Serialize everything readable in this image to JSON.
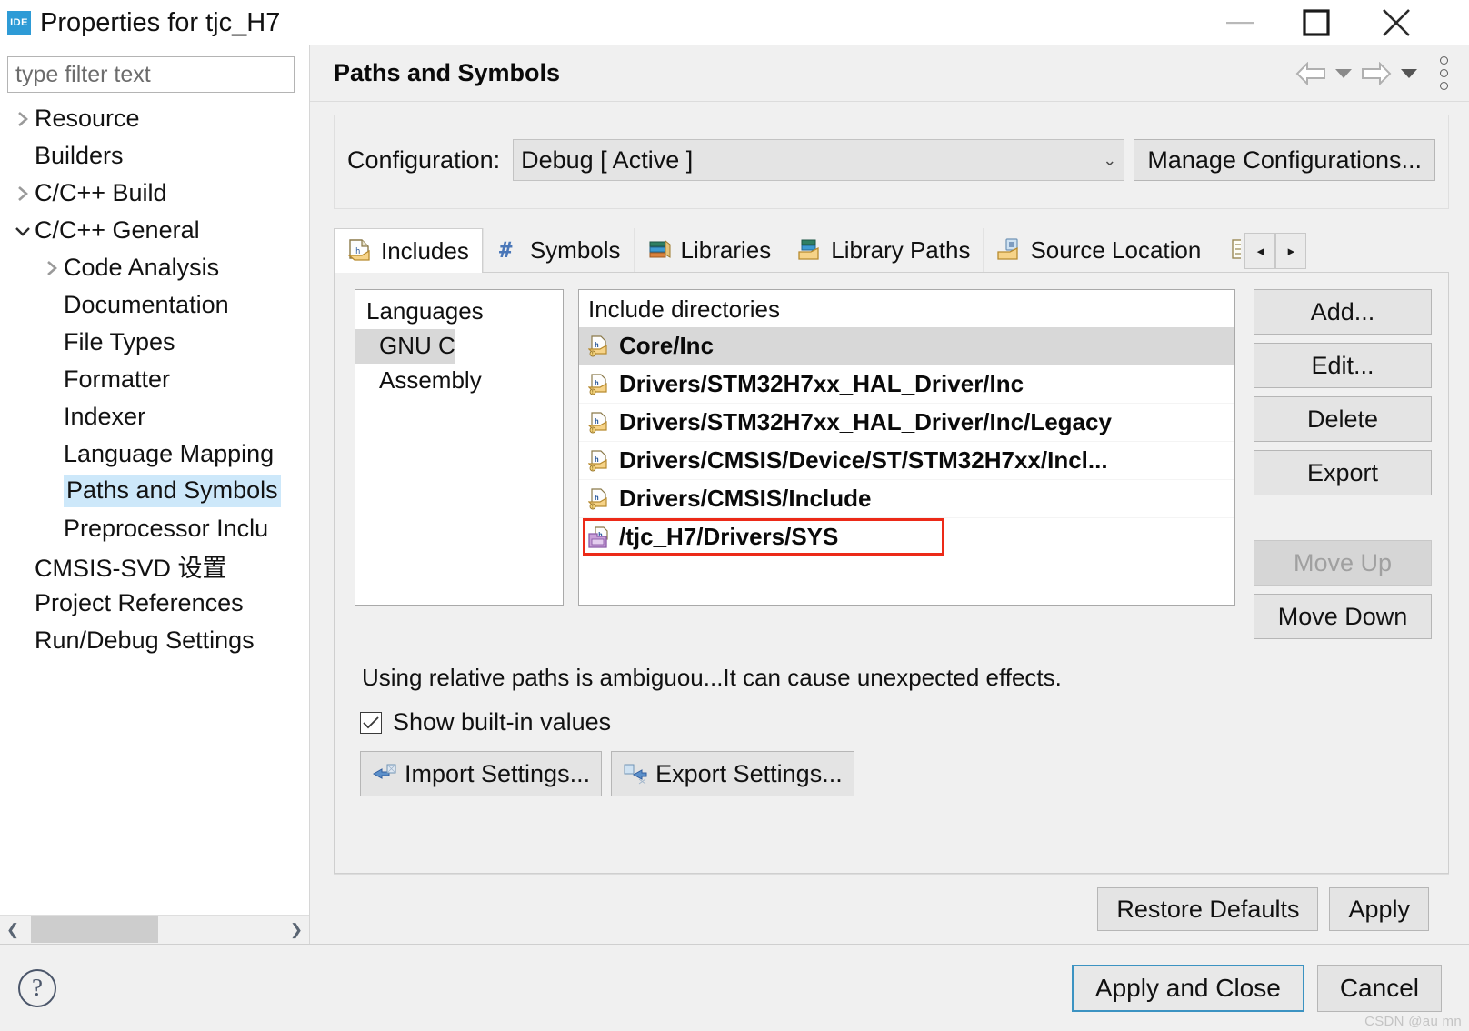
{
  "window": {
    "app_badge": "IDE",
    "title": "Properties for tjc_H7",
    "minimize_label": "minimize-icon",
    "maximize_label": "maximize-icon",
    "close_label": "close-icon"
  },
  "filter": {
    "placeholder": "type filter text",
    "value": ""
  },
  "tree": [
    {
      "label": "Resource",
      "indent": 0,
      "twisty": "collapsed",
      "selected": false
    },
    {
      "label": "Builders",
      "indent": 0,
      "twisty": "none",
      "selected": false
    },
    {
      "label": "C/C++ Build",
      "indent": 0,
      "twisty": "collapsed",
      "selected": false
    },
    {
      "label": "C/C++ General",
      "indent": 0,
      "twisty": "expanded",
      "selected": false
    },
    {
      "label": "Code Analysis",
      "indent": 1,
      "twisty": "collapsed",
      "selected": false
    },
    {
      "label": "Documentation",
      "indent": 1,
      "twisty": "none",
      "selected": false
    },
    {
      "label": "File Types",
      "indent": 1,
      "twisty": "none",
      "selected": false
    },
    {
      "label": "Formatter",
      "indent": 1,
      "twisty": "none",
      "selected": false
    },
    {
      "label": "Indexer",
      "indent": 1,
      "twisty": "none",
      "selected": false
    },
    {
      "label": "Language Mapping",
      "indent": 1,
      "twisty": "none",
      "selected": false
    },
    {
      "label": "Paths and Symbols",
      "indent": 1,
      "twisty": "none",
      "selected": true
    },
    {
      "label": "Preprocessor Inclu",
      "indent": 1,
      "twisty": "none",
      "selected": false
    },
    {
      "label": "CMSIS-SVD 设置",
      "indent": 0,
      "twisty": "none",
      "selected": false
    },
    {
      "label": "Project References",
      "indent": 0,
      "twisty": "none",
      "selected": false
    },
    {
      "label": "Run/Debug Settings",
      "indent": 0,
      "twisty": "none",
      "selected": false
    }
  ],
  "header": {
    "page_title": "Paths and Symbols",
    "back_icon": "back-arrow-icon",
    "back_caret": "▼",
    "forward_icon": "forward-arrow-icon",
    "forward_caret": "▼",
    "menu_icon": "vertical-dots-icon"
  },
  "configuration": {
    "label": "Configuration:",
    "value": "Debug  [ Active ]",
    "chevron": "⌄",
    "manage_label": "Manage Configurations..."
  },
  "tabs": [
    {
      "label": "Includes",
      "icon": "include-file-icon",
      "active": true
    },
    {
      "label": "Symbols",
      "icon": "hash-icon",
      "active": false
    },
    {
      "label": "Libraries",
      "icon": "books-icon",
      "active": false
    },
    {
      "label": "Library Paths",
      "icon": "folder-books-icon",
      "active": false
    },
    {
      "label": "Source Location",
      "icon": "folder-source-icon",
      "active": false
    },
    {
      "label": "",
      "icon": "output-folder-icon",
      "active": false
    }
  ],
  "tab_scroll": {
    "left": "◂",
    "right": "▸"
  },
  "languages": {
    "header": "Languages",
    "items": [
      {
        "label": "GNU C",
        "selected": true
      },
      {
        "label": "Assembly",
        "selected": false
      }
    ]
  },
  "include_directories": {
    "header": "Include directories",
    "items": [
      {
        "path": "Core/Inc",
        "selected": true,
        "annotated": false,
        "icon": "include-folder-icon"
      },
      {
        "path": "Drivers/STM32H7xx_HAL_Driver/Inc",
        "selected": false,
        "annotated": false,
        "icon": "include-folder-icon"
      },
      {
        "path": "Drivers/STM32H7xx_HAL_Driver/Inc/Legacy",
        "selected": false,
        "annotated": false,
        "icon": "include-folder-icon"
      },
      {
        "path": "Drivers/CMSIS/Device/ST/STM32H7xx/Incl...",
        "selected": false,
        "annotated": false,
        "icon": "include-folder-icon"
      },
      {
        "path": "Drivers/CMSIS/Include",
        "selected": false,
        "annotated": false,
        "icon": "include-folder-icon"
      },
      {
        "path": "/tjc_H7/Drivers/SYS",
        "selected": false,
        "annotated": true,
        "icon": "workspace-folder-icon"
      }
    ]
  },
  "side_buttons": [
    {
      "label": "Add...",
      "enabled": true,
      "spaced": false
    },
    {
      "label": "Edit...",
      "enabled": true,
      "spaced": false
    },
    {
      "label": "Delete",
      "enabled": true,
      "spaced": false
    },
    {
      "label": "Export",
      "enabled": true,
      "spaced": false
    },
    {
      "label": "Move Up",
      "enabled": false,
      "spaced": true
    },
    {
      "label": "Move Down",
      "enabled": true,
      "spaced": false
    }
  ],
  "note": "Using relative paths is ambiguou...It can cause unexpected effects.",
  "show_builtin": {
    "label": "Show built-in values",
    "checked": true
  },
  "settings_buttons": [
    {
      "label": "Import Settings...",
      "icon": "import-icon"
    },
    {
      "label": "Export Settings...",
      "icon": "export-icon"
    }
  ],
  "apply_row": [
    {
      "label": "Restore Defaults"
    },
    {
      "label": "Apply"
    }
  ],
  "footer": {
    "help_icon": "question-mark-icon",
    "buttons": [
      {
        "label": "Apply and Close",
        "focused": true
      },
      {
        "label": "Cancel",
        "focused": false
      }
    ]
  },
  "watermark": "CSDN @au mn",
  "colors": {
    "accent": "#2e9bd6",
    "tree_selection": "#cde8fa",
    "list_selection": "#d8d8d8",
    "annotation": "#ec2a18",
    "focus_border": "#3c93c2",
    "dialog_bg": "#f0f0f0"
  }
}
